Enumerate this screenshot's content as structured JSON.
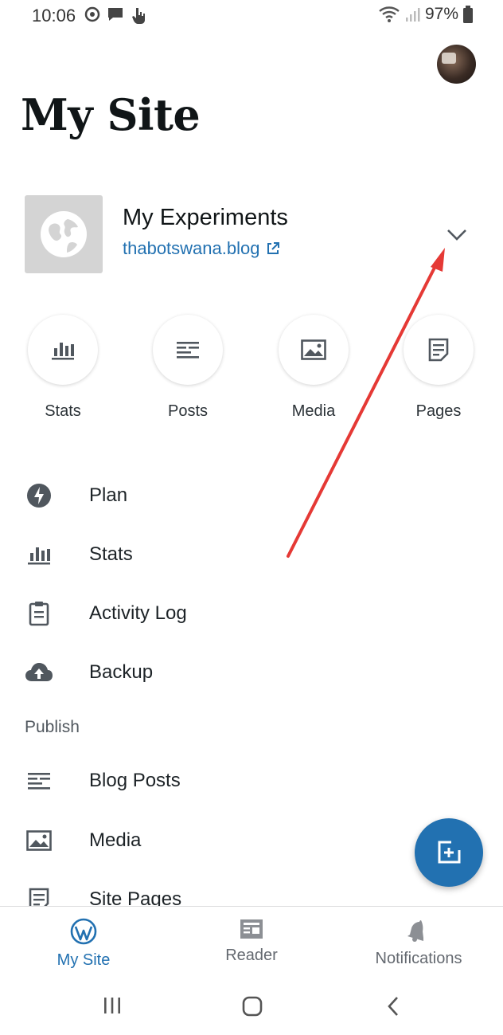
{
  "status_bar": {
    "time": "10:06",
    "battery": "97%"
  },
  "header": {
    "title": "My Site"
  },
  "site": {
    "name": "My Experiments",
    "url": "thabotswana.blog"
  },
  "quick_actions": [
    {
      "label": "Stats",
      "icon": "stats-icon"
    },
    {
      "label": "Posts",
      "icon": "posts-icon"
    },
    {
      "label": "Media",
      "icon": "media-icon"
    },
    {
      "label": "Pages",
      "icon": "pages-icon"
    }
  ],
  "menu": {
    "items": [
      {
        "label": "Plan",
        "icon": "plan-icon"
      },
      {
        "label": "Stats",
        "icon": "stats-icon"
      },
      {
        "label": "Activity Log",
        "icon": "clipboard-icon"
      },
      {
        "label": "Backup",
        "icon": "cloud-upload-icon"
      }
    ],
    "publish_header": "Publish",
    "publish_items": [
      {
        "label": "Blog Posts",
        "icon": "posts-icon"
      },
      {
        "label": "Media",
        "icon": "media-icon"
      },
      {
        "label": "Site Pages",
        "icon": "pages-icon"
      }
    ]
  },
  "bottom_nav": {
    "items": [
      {
        "label": "My Site",
        "icon": "wordpress-icon",
        "active": true
      },
      {
        "label": "Reader",
        "icon": "reader-icon",
        "active": false
      },
      {
        "label": "Notifications",
        "icon": "bell-icon",
        "active": false
      }
    ]
  },
  "colors": {
    "accent": "#2271b1",
    "annotation": "#e53935",
    "icon_gray": "#50575e"
  }
}
